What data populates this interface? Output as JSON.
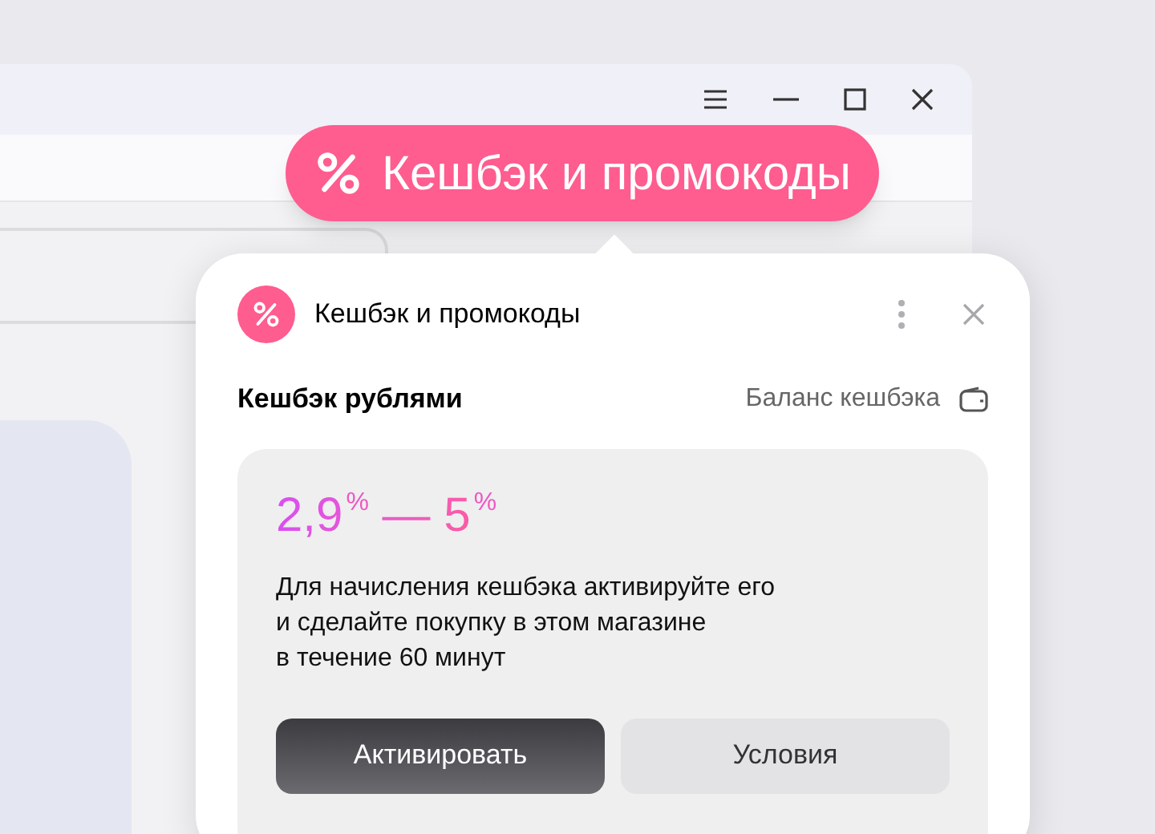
{
  "badge": {
    "label": "Кешбэк и промокоды"
  },
  "popup": {
    "title": "Кешбэк и промокоды",
    "section": "Кешбэк рублями",
    "balance_link": "Баланс кешбэка",
    "offer": {
      "range": "2,9$^{%}$ — 5$^{%}$",
      "description": "Для начисления кешбэка активируйте его\nи сделайте покупку в этом магазине\nв течение 60 минут",
      "buttons": [
        {
          "label": "Активировать",
          "kind": "primary"
        },
        {
          "label": "Условия",
          "kind": "secondary"
        }
      ]
    }
  }
}
